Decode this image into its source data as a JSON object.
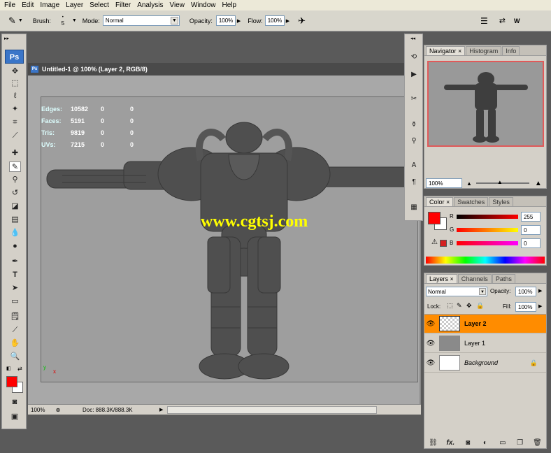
{
  "menu": [
    "File",
    "Edit",
    "Image",
    "Layer",
    "Select",
    "Filter",
    "Analysis",
    "View",
    "Window",
    "Help"
  ],
  "options": {
    "brush_label": "Brush:",
    "brush_size": "5",
    "mode_label": "Mode:",
    "mode_value": "Normal",
    "opacity_label": "Opacity:",
    "opacity_value": "100%",
    "flow_label": "Flow:",
    "flow_value": "100%",
    "workspace_letter": "W"
  },
  "toolbox": {
    "logo": "Ps"
  },
  "document": {
    "title": "Untitled-1 @ 100% (Layer 2, RGB/8)",
    "ps_icon": "Ps",
    "zoom": "100%",
    "doc_info": "Doc: 888.3K/888.3K"
  },
  "viewport_stats": {
    "rows": [
      {
        "label": "Edges:",
        "v1": "10582",
        "v2": "0",
        "v3": "0"
      },
      {
        "label": "Faces:",
        "v1": "5191",
        "v2": "0",
        "v3": "0"
      },
      {
        "label": "Tris:",
        "v1": "9819",
        "v2": "0",
        "v3": "0"
      },
      {
        "label": "UVs:",
        "v1": "7215",
        "v2": "0",
        "v3": "0"
      }
    ],
    "axis_y": "y",
    "axis_x": "x"
  },
  "watermark": "www.cgtsj.com",
  "navigator": {
    "tabs": [
      "Navigator",
      "Histogram",
      "Info"
    ],
    "zoom": "100%"
  },
  "color": {
    "tabs": [
      "Color",
      "Swatches",
      "Styles"
    ],
    "r_label": "R",
    "r_value": "255",
    "g_label": "G",
    "g_value": "0",
    "b_label": "B",
    "b_value": "0",
    "fg": "#ff0000",
    "bg": "#ffffff"
  },
  "layers": {
    "tabs": [
      "Layers",
      "Channels",
      "Paths"
    ],
    "blend_mode": "Normal",
    "opacity_label": "Opacity:",
    "opacity_value": "100%",
    "lock_label": "Lock:",
    "fill_label": "Fill:",
    "fill_value": "100%",
    "items": [
      {
        "name": "Layer 2"
      },
      {
        "name": "Layer 1"
      },
      {
        "name": "Background"
      }
    ],
    "footer_fx": "fx."
  }
}
